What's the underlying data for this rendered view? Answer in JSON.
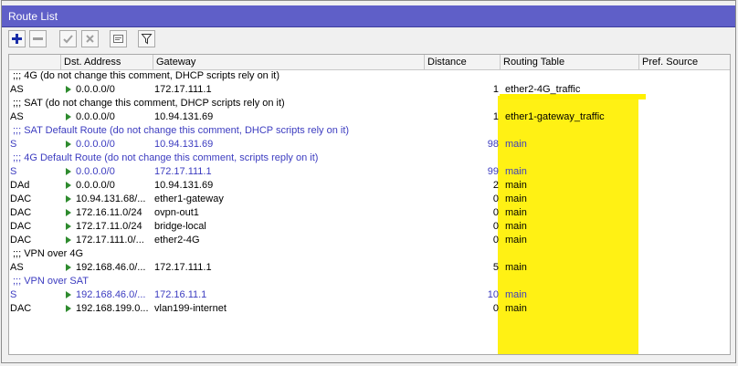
{
  "window": {
    "title": "Route List"
  },
  "toolbar": {
    "buttons": [
      {
        "name": "add-button",
        "icon": "plus-icon"
      },
      {
        "name": "remove-button",
        "icon": "minus-icon"
      },
      {
        "name": "enable-button",
        "icon": "check-icon"
      },
      {
        "name": "disable-button",
        "icon": "x-icon"
      },
      {
        "name": "comment-button",
        "icon": "comment-icon"
      },
      {
        "name": "filter-button",
        "icon": "filter-icon"
      }
    ]
  },
  "table": {
    "columns": {
      "flags": "",
      "dst": "Dst. Address",
      "gateway": "Gateway",
      "distance": "Distance",
      "routing_table": "Routing Table",
      "pref_source": "Pref. Source"
    },
    "rows": [
      {
        "comment": ";;; 4G (do not change this comment, DHCP scripts rely on it)"
      },
      {
        "flags": "AS",
        "dst": "0.0.0.0/0",
        "gateway": "172.17.111.1",
        "distance": "1",
        "routing_table": "ether2-4G_traffic"
      },
      {
        "comment": ";;; SAT (do not change this comment, DHCP scripts rely on it)"
      },
      {
        "flags": "AS",
        "dst": "0.0.0.0/0",
        "gateway": "10.94.131.69",
        "distance": "1",
        "routing_table": "ether1-gateway_traffic"
      },
      {
        "comment": ";;; SAT Default Route (do not change this comment, DHCP scripts rely on it)",
        "disabled": true
      },
      {
        "flags": "S",
        "dst": "0.0.0.0/0",
        "gateway": "10.94.131.69",
        "distance": "98",
        "routing_table": "main",
        "disabled": true
      },
      {
        "comment": ";;; 4G Default Route (do not change this comment, scripts reply on it)",
        "disabled": true
      },
      {
        "flags": "S",
        "dst": "0.0.0.0/0",
        "gateway": "172.17.111.1",
        "distance": "99",
        "routing_table": "main",
        "disabled": true
      },
      {
        "flags": "DAd",
        "dst": "0.0.0.0/0",
        "gateway": "10.94.131.69",
        "distance": "2",
        "routing_table": "main"
      },
      {
        "flags": "DAC",
        "dst": "10.94.131.68/...",
        "gateway": "ether1-gateway",
        "distance": "0",
        "routing_table": "main"
      },
      {
        "flags": "DAC",
        "dst": "172.16.11.0/24",
        "gateway": "ovpn-out1",
        "distance": "0",
        "routing_table": "main"
      },
      {
        "flags": "DAC",
        "dst": "172.17.11.0/24",
        "gateway": "bridge-local",
        "distance": "0",
        "routing_table": "main"
      },
      {
        "flags": "DAC",
        "dst": "172.17.111.0/...",
        "gateway": "ether2-4G",
        "distance": "0",
        "routing_table": "main"
      },
      {
        "comment": ";;; VPN over 4G"
      },
      {
        "flags": "AS",
        "dst": "192.168.46.0/...",
        "gateway": "172.17.111.1",
        "distance": "5",
        "routing_table": "main"
      },
      {
        "comment": ";;; VPN over SAT",
        "disabled": true
      },
      {
        "flags": "S",
        "dst": "192.168.46.0/...",
        "gateway": "172.16.11.1",
        "distance": "10",
        "routing_table": "main",
        "disabled": true
      },
      {
        "flags": "DAC",
        "dst": "192.168.199.0...",
        "gateway": "vlan199-internet",
        "distance": "0",
        "routing_table": "main"
      }
    ]
  },
  "colors": {
    "titlebar": "#5f5fc8",
    "highlight": "#fff000",
    "disabled_text": "#3c3cc0",
    "route_arrow": "#2e8b2e"
  }
}
